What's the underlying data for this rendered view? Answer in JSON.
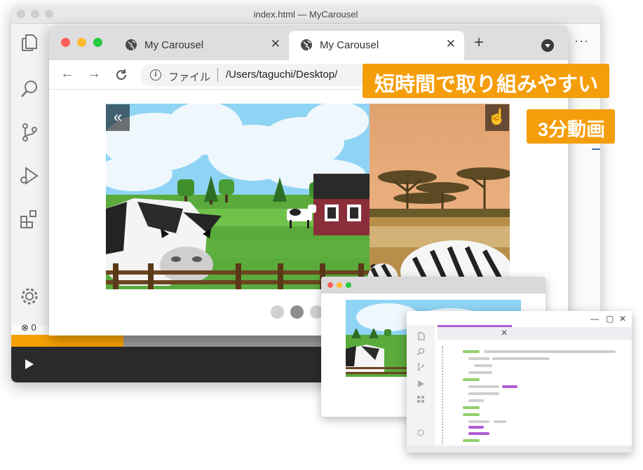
{
  "vscode": {
    "title": "index.html — MyCarousel",
    "more_label": "···",
    "status_text": "0",
    "activity_icons": [
      "files-icon",
      "search-icon",
      "source-control-icon",
      "run-debug-icon",
      "extensions-icon",
      "settings-gear-icon"
    ],
    "video": {
      "progress": 0.19,
      "play_icon": "play-icon"
    }
  },
  "browser": {
    "tabs": [
      {
        "label": "My Carousel",
        "active": false
      },
      {
        "label": "My Carousel",
        "active": true
      }
    ],
    "new_tab_label": "+",
    "address": {
      "scheme_label": "ファイル",
      "path": "/Users/taguchi/Desktop/"
    },
    "carousel": {
      "prev_label": "«",
      "next_label": "»",
      "dots": [
        {
          "active": false
        },
        {
          "active": true
        },
        {
          "active": false
        }
      ]
    }
  },
  "badges": {
    "headline": "短時間で取り組みやすい",
    "video_length": "3分動画"
  },
  "colors": {
    "accent_orange": "#f59e0b",
    "progress_orange": "#f5a103",
    "mac_red": "#ff5f57",
    "mac_yellow": "#febc2e",
    "mac_green": "#28c840",
    "code_green": "#8fd16c",
    "code_purple": "#b15cd6"
  }
}
